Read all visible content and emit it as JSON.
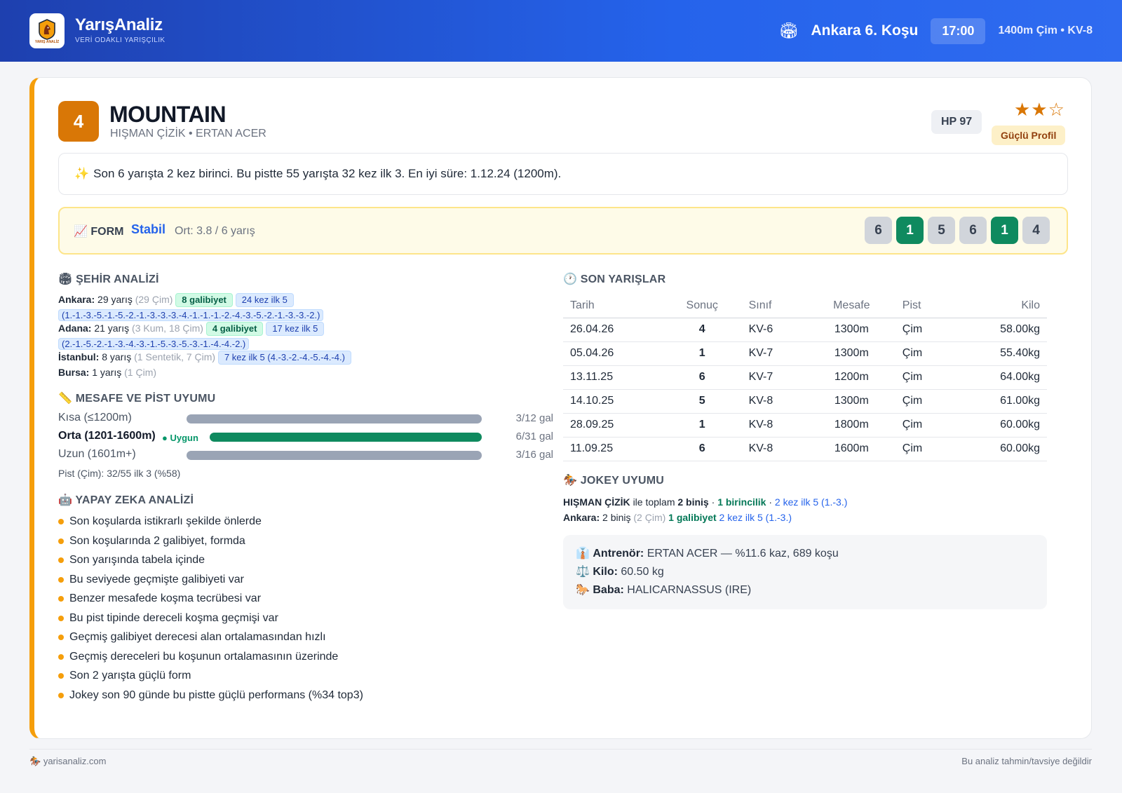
{
  "header": {
    "brand_name": "YarışAnaliz",
    "brand_tag": "VERİ ODAKLI YARIŞÇILIK",
    "logo_text": "YARIŞ ANALİZ",
    "race_title": "Ankara 6. Koşu",
    "race_time": "17:00",
    "race_meta": "1400m Çim • KV-8"
  },
  "horse": {
    "number": "4",
    "name": "MOUNTAIN",
    "subtitle": "HIŞMAN ÇİZİK • ERTAN ACER",
    "hp": "HP 97",
    "stars": "★★☆",
    "profile": "Güçlü Profil",
    "summary": "Son 6 yarışta 2 kez birinci. Bu pistte 55 yarışta 32 kez ilk 3. En iyi süre: 1.12.24 (1200m)."
  },
  "form": {
    "label": "FORM",
    "state": "Stabil",
    "avg": "Ort: 3.8 / 6 yarış",
    "results": [
      "6",
      "1",
      "5",
      "6",
      "1",
      "4"
    ]
  },
  "city": {
    "title": "ŞEHİR ANALİZİ",
    "ankara": {
      "city": "Ankara:",
      "count": "29 yarış",
      "detail": "(29 Çim)",
      "wins": "8 galibiyet",
      "top5": "24 kez ilk 5",
      "seq": "(1.-1.-3.-5.-1.-5.-2.-1.-3.-3.-3.-4.-1.-1.-1.-2.-4.-3.-5.-2.-1.-3.-3.-2.)"
    },
    "adana": {
      "city": "Adana:",
      "count": "21 yarış",
      "detail": "(3 Kum, 18 Çim)",
      "wins": "4 galibiyet",
      "top5": "17 kez ilk 5",
      "seq": "(2.-1.-5.-2.-1.-3.-4.-3.-1.-5.-3.-5.-3.-1.-4.-4.-2.)"
    },
    "istanbul": {
      "city": "İstanbul:",
      "count": "8 yarış",
      "detail": "(1 Sentetik, 7 Çim)",
      "top5": "7 kez ilk 5 (4.-3.-2.-4.-5.-4.-4.)"
    },
    "bursa": {
      "city": "Bursa:",
      "count": "1 yarış",
      "detail": "(1 Çim)"
    }
  },
  "distance": {
    "title": "MESAFE VE PİST UYUMU",
    "rows": [
      {
        "label": "Kısa (≤1200m)",
        "value": "3/12 gal"
      },
      {
        "label": "Orta (1201-1600m)",
        "badge": "● Uygun",
        "value": "6/31 gal"
      },
      {
        "label": "Uzun (1601m+)",
        "value": "3/16 gal"
      }
    ],
    "pist": "Pist (Çim): 32/55 ilk 3 (%58)"
  },
  "ai": {
    "title": "YAPAY ZEKA ANALİZİ",
    "items": [
      "Son koşularda istikrarlı şekilde önlerde",
      "Son koşularında 2 galibiyet, formda",
      "Son yarışında tabela içinde",
      "Bu seviyede geçmişte galibiyeti var",
      "Benzer mesafede koşma tecrübesi var",
      "Bu pist tipinde dereceli koşma geçmişi var",
      "Geçmiş galibiyet derecesi alan ortalamasından hızlı",
      "Geçmiş dereceleri bu koşunun ortalamasının üzerinde",
      "Son 2 yarışta güçlü form",
      "Jokey son 90 günde bu pistte güçlü performans (%34 top3)"
    ]
  },
  "races": {
    "title": "SON YARIŞLAR",
    "columns": [
      "Tarih",
      "Sonuç",
      "Sınıf",
      "Mesafe",
      "Pist",
      "Kilo"
    ],
    "rows": [
      [
        "26.04.26",
        "4",
        "KV-6",
        "1300m",
        "Çim",
        "58.00kg"
      ],
      [
        "05.04.26",
        "1",
        "KV-7",
        "1300m",
        "Çim",
        "55.40kg"
      ],
      [
        "13.11.25",
        "6",
        "KV-7",
        "1200m",
        "Çim",
        "64.00kg"
      ],
      [
        "14.10.25",
        "5",
        "KV-8",
        "1300m",
        "Çim",
        "61.00kg"
      ],
      [
        "28.09.25",
        "1",
        "KV-8",
        "1800m",
        "Çim",
        "60.00kg"
      ],
      [
        "11.09.25",
        "6",
        "KV-8",
        "1600m",
        "Çim",
        "60.00kg"
      ]
    ]
  },
  "jokey": {
    "title": "JOKEY UYUMU",
    "name": "HIŞMAN ÇİZİK",
    "l1_text": "ile toplam",
    "l1_rides": "2 biniş",
    "l1_wins": "1 birincilik",
    "l1_top5": "2 kez ilk 5 (1.-3.)",
    "l2_city": "Ankara:",
    "l2_rides": "2 biniş",
    "l2_detail": "(2 Çim)",
    "l2_wins": "1 galibiyet",
    "l2_top5": "2 kez ilk 5 (1.-3.)"
  },
  "info": {
    "trainer_label": "Antrenör:",
    "trainer_value": "ERTAN ACER — %11.6 kaz, 689 koşu",
    "weight_label": "Kilo:",
    "weight_value": "60.50 kg",
    "sire_label": "Baba:",
    "sire_value": "HALICARNASSUS (IRE)"
  },
  "footer": {
    "site": "yarisanaliz.com",
    "disclaimer": "Bu analiz tahmin/tavsiye değildir"
  },
  "colors": {
    "header_blue": "#2563eb",
    "accent_orange": "#d97706",
    "win_green": "#0f8a5f",
    "form_state_blue": "#2563eb"
  }
}
